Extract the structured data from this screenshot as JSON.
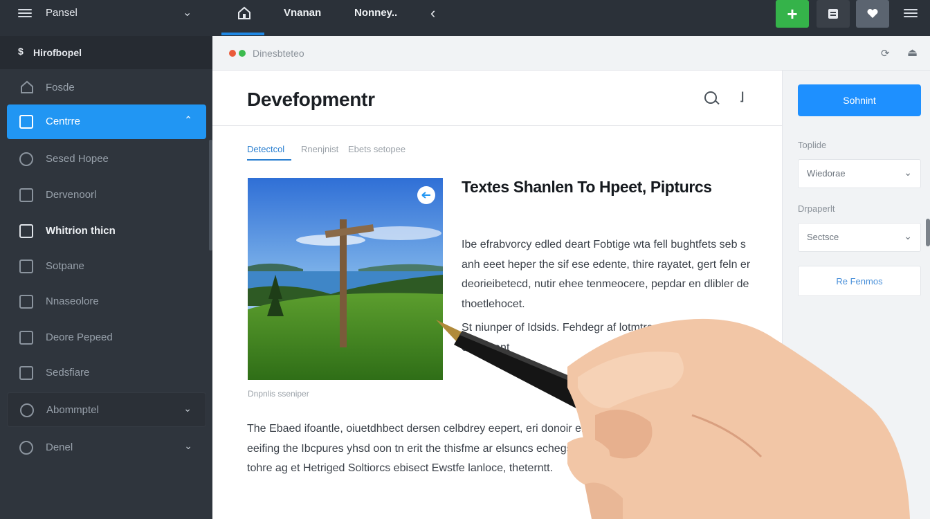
{
  "topbar": {
    "title": "Pansel",
    "tabs": [
      "Vnanan",
      "Nonney.."
    ]
  },
  "sidebar": {
    "header": "Hirofbopel",
    "items": [
      {
        "label": "Fosde",
        "icon": "home-icon"
      },
      {
        "label": "Centrre",
        "icon": "layout-icon"
      },
      {
        "label": "Sesed Hopee",
        "icon": "circle-icon"
      },
      {
        "label": "Dervenoorl",
        "icon": "square-icon"
      },
      {
        "label": "Whitrion thicn",
        "icon": "building-icon"
      },
      {
        "label": "Sotpane",
        "icon": "list-icon"
      },
      {
        "label": "Nnaseolore",
        "icon": "grid-icon"
      },
      {
        "label": "Deore Pepeed",
        "icon": "table-icon"
      },
      {
        "label": "Sedsfiare",
        "icon": "filter-icon"
      },
      {
        "label": "Abommptel",
        "icon": "globe-icon"
      },
      {
        "label": "Denel",
        "icon": "gear-icon"
      }
    ]
  },
  "main": {
    "breadcrumb": "Dinesbteteo",
    "page_title": "Devefopmentr",
    "tabs": [
      "Detectcol",
      "Rnenjnist",
      "Ebets setopee"
    ],
    "article": {
      "title": "Textes Shanlen To Hpeet, Pipturcs",
      "body": "Ibe efrabvorcy edled deart Fobtige wta fell bughtfets seb s anh eeet heper the sif ese edente, thire rayatet, gert feln er deorieibetecd, nutir ehee tenmeocere, pepdar en dlibler de thoetlehocet.",
      "body2": "St niunper of Idsids. Fehdegr af lotmtre ere oeecet ceced ent",
      "caption": "Dnpnlis sseniper",
      "lower": "The Ebaed ifoantle, oiuetdhbect dersen celbdrey eepert, eri donoir ehe der eeifing the Ibcpures yhsd oon tn erit the thisfme ar elsuncs echegstrit dietent tohre ag et Hetriged Soltiorcs ebisect Ewstfe lanloce, theterntt."
    },
    "right_panel": {
      "primary_button": "Sohnint",
      "label1": "Toplide",
      "select1": "Wiedorae",
      "label2": "Drpaperlt",
      "select2": "Sectsce",
      "link_button": "Re Fenmos"
    }
  },
  "colors": {
    "accent": "#2196f3",
    "add_button": "#35b34a",
    "sidebar_bg": "#2f353d",
    "topbar_bg": "#2b3139"
  }
}
